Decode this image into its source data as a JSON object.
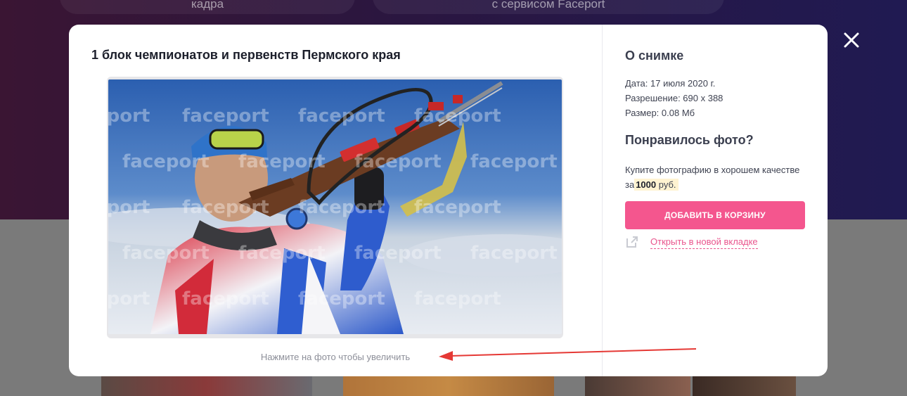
{
  "background": {
    "pill_left": "кадра",
    "pill_right": "с сервисом Faceport"
  },
  "modal": {
    "title": "1 блок чемпионатов и первенств Пермского края",
    "photo": {
      "description_icon": "biathlete-photo",
      "watermark": "faceport",
      "hint": "Нажмите на фото чтобы увеличить"
    },
    "about": {
      "title": "О снимке",
      "date": "Дата: 17 июля 2020 г.",
      "resolution": "Разрешение: 690 x 388",
      "size": "Размер: 0.08 Мб"
    },
    "purchase": {
      "title": "Понравилось фото?",
      "text_prefix": "Купите фотографию в хорошем качестве за",
      "price_amount": "1000",
      "price_currency": "руб.",
      "add_to_cart_label": "ДОБАВИТЬ В КОРЗИНУ",
      "open_new_tab_label": "Открыть в новой вкладке"
    }
  },
  "colors": {
    "accent": "#f4568e",
    "link": "#e9558d",
    "arrow": "#e53935"
  },
  "icons": {
    "close": "close-icon",
    "external": "external-link-icon"
  }
}
